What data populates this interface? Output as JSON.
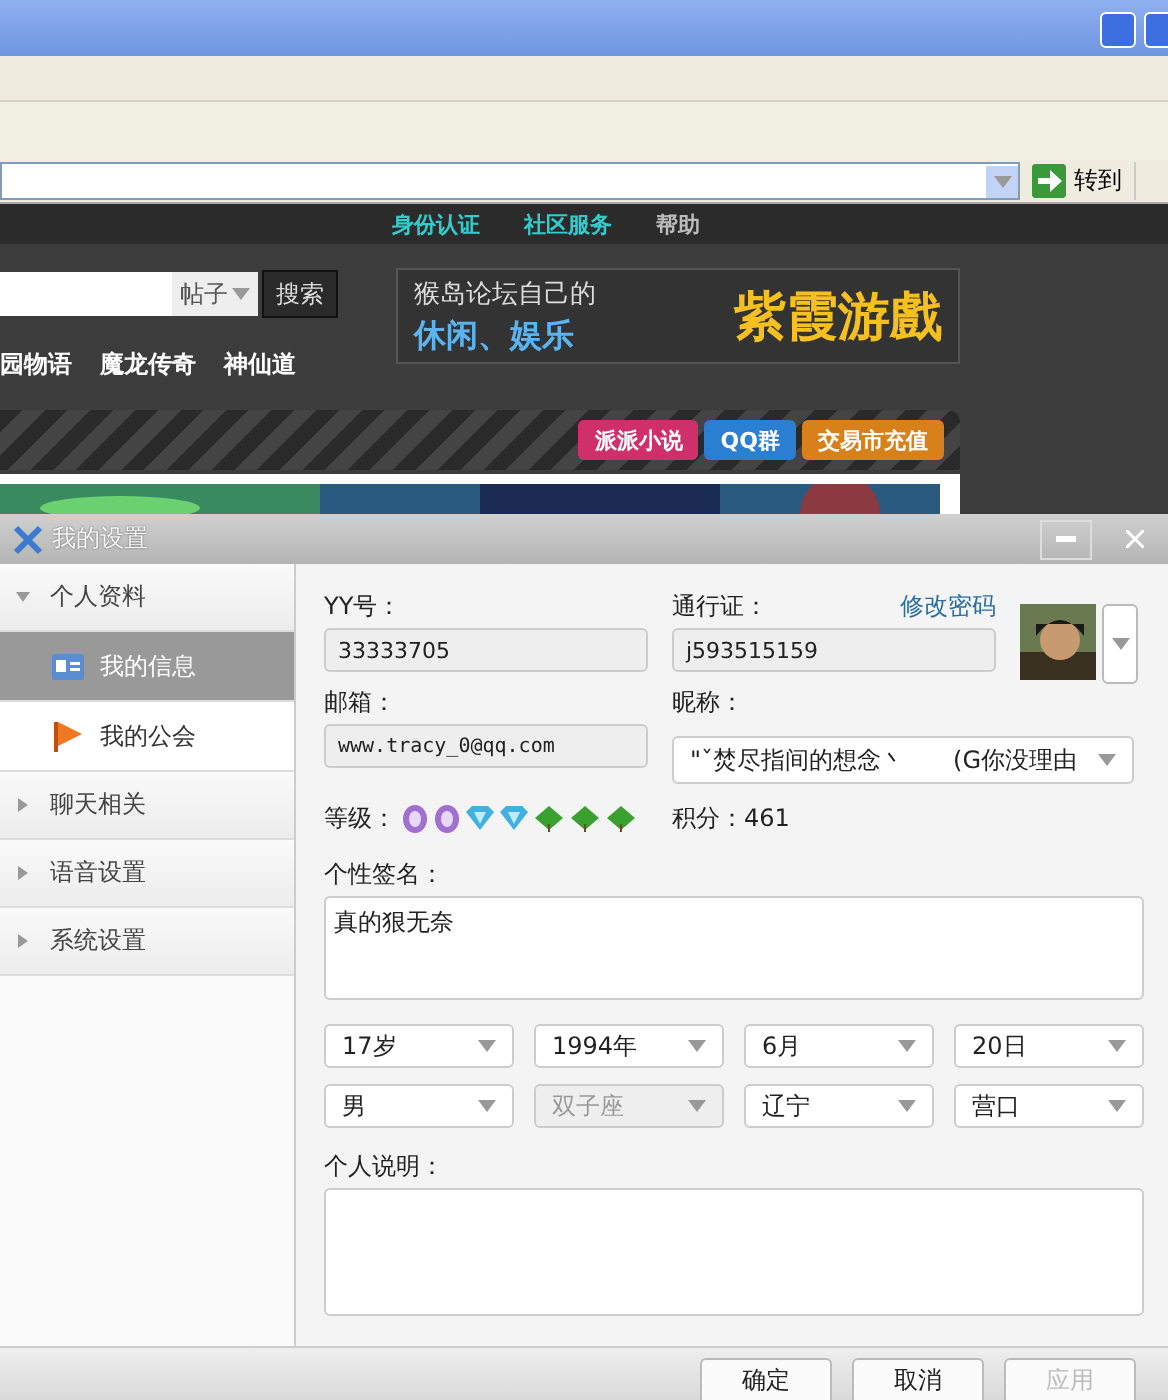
{
  "browser": {
    "go_button": "转到",
    "page": {
      "top_links": [
        {
          "label": "身份认证",
          "color": "#33cccc"
        },
        {
          "label": "社区服务",
          "color": "#33cccc"
        },
        {
          "label": "帮助",
          "color": "#bbbbbb"
        }
      ],
      "search": {
        "scope": "帖子",
        "button": "搜索"
      },
      "nav_links": [
        "园物语",
        "魔龙传奇",
        "神仙道"
      ],
      "banner": {
        "line1": "猴岛论坛自己的",
        "line2": "休闲、娱乐",
        "brand": "紫霞游戲"
      },
      "promo_buttons": [
        {
          "label": "派派小说",
          "color": "#d0306a"
        },
        {
          "label": "QQ群",
          "color": "#2a7fd0"
        },
        {
          "label": "交易市充值",
          "color": "#d8801a"
        }
      ]
    }
  },
  "dialog": {
    "title": "我的设置",
    "sidebar": [
      {
        "label": "个人资料",
        "expanded": true,
        "children": [
          {
            "label": "我的信息",
            "selected": true,
            "kind": "card"
          },
          {
            "label": "我的公会",
            "selected": false,
            "kind": "flag"
          }
        ]
      },
      {
        "label": "聊天相关",
        "expanded": false
      },
      {
        "label": "语音设置",
        "expanded": false
      },
      {
        "label": "系统设置",
        "expanded": false
      }
    ],
    "yy_label": "YY号：",
    "yy_value": "33333705",
    "pass_label": "通行证：",
    "change_password": "修改密码",
    "pass_value": "j593515159",
    "email_label": "邮箱：",
    "email_value": "www.tracy_0@qq.com",
    "nick_label": "昵称：",
    "nick_value": "\"ˇ焚尽指间的想念丶　　(G你没理由",
    "level_label": "等级：",
    "level_icons": [
      {
        "kind": "badge"
      },
      {
        "kind": "badge"
      },
      {
        "kind": "gem"
      },
      {
        "kind": "gem"
      },
      {
        "kind": "leaf"
      },
      {
        "kind": "leaf"
      },
      {
        "kind": "leaf"
      }
    ],
    "points": "积分：461",
    "signature_label": "个性签名：",
    "signature": "真的狠无奈",
    "selects": [
      {
        "value": "17岁",
        "disabled": false
      },
      {
        "value": "1994年",
        "disabled": false
      },
      {
        "value": "6月",
        "disabled": false
      },
      {
        "value": "20日",
        "disabled": false
      },
      {
        "value": "男",
        "disabled": false
      },
      {
        "value": "双子座",
        "disabled": true
      },
      {
        "value": "辽宁",
        "disabled": false
      },
      {
        "value": "营口",
        "disabled": false
      }
    ],
    "about_label": "个人说明：",
    "buttons": [
      {
        "label": "确定",
        "disabled": false
      },
      {
        "label": "取消",
        "disabled": false
      },
      {
        "label": "应用",
        "disabled": true
      }
    ]
  }
}
